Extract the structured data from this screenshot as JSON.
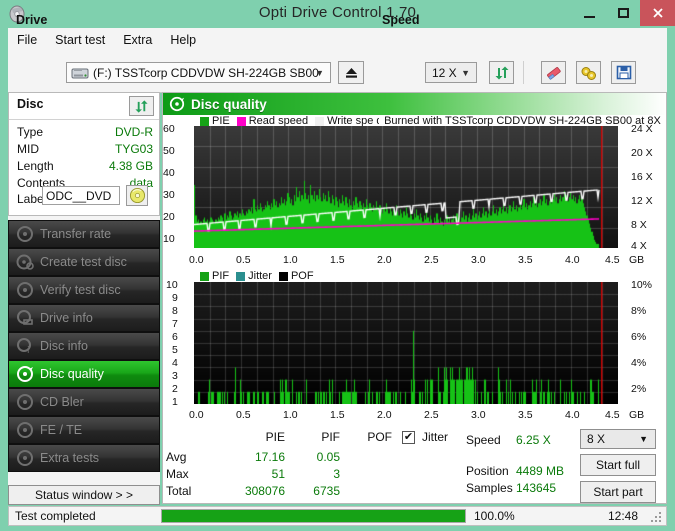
{
  "window": {
    "title": "Opti Drive Control 1.70",
    "icon": "disc-icon",
    "minimize": "minimize",
    "maximize": "maximize",
    "close": "close"
  },
  "menu": {
    "items": [
      "File",
      "Start test",
      "Extra",
      "Help"
    ]
  },
  "toolbar": {
    "drive_label": "Drive",
    "drive_value": "(F:)  TSSTcorp CDDVDW SH-224GB SB00",
    "eject_icon": "eject-icon",
    "speed_label": "Speed",
    "speed_value": "12 X",
    "refresh_icon": "refresh-icon",
    "erase_icon": "eraser-icon",
    "settings_icon": "gear-icon",
    "save_icon": "save-icon"
  },
  "disc": {
    "title": "Disc",
    "refresh_icon": "refresh-icon",
    "rows": [
      {
        "key": "Type",
        "value": "DVD-R"
      },
      {
        "key": "MID",
        "value": "TYG03"
      },
      {
        "key": "Length",
        "value": "4.38 GB"
      },
      {
        "key": "Contents",
        "value": "data"
      }
    ],
    "label_key": "Label",
    "label_value": "ODC__DVD",
    "label_button_icon": "cd-icon"
  },
  "sidebar": {
    "items": [
      {
        "label": "Transfer rate",
        "icon": "disc-icon",
        "active": false
      },
      {
        "label": "Create test disc",
        "icon": "disc-write-icon",
        "active": false
      },
      {
        "label": "Verify test disc",
        "icon": "disc-check-icon",
        "active": false
      },
      {
        "label": "Drive info",
        "icon": "drive-icon",
        "active": false
      },
      {
        "label": "Disc info",
        "icon": "disc-info-icon",
        "active": false
      },
      {
        "label": "Disc quality",
        "icon": "disc-quality-icon",
        "active": true
      },
      {
        "label": "CD Bler",
        "icon": "disc-icon",
        "active": false
      },
      {
        "label": "FE / TE",
        "icon": "disc-icon",
        "active": false
      },
      {
        "label": "Extra tests",
        "icon": "disc-icon",
        "active": false
      }
    ],
    "status_window": "Status window > >"
  },
  "panel": {
    "header": "Disc quality",
    "header_icon": "disc-quality-icon"
  },
  "chart_data": [
    {
      "type": "area",
      "title": "Disc quality",
      "annotation": "Burned with TSSTcorp CDDVDW SH-224GB SB00 at 8X",
      "legend": [
        {
          "label": "PIE",
          "color": "#16a216"
        },
        {
          "label": "Read speed",
          "color": "#ff00c8"
        },
        {
          "label": "Write spe  d",
          "color": "#f0f0f0"
        }
      ],
      "xlabel": "GB",
      "x_ticks": [
        "0.0",
        "0.5",
        "1.0",
        "1.5",
        "2.0",
        "2.5",
        "3.0",
        "3.5",
        "4.0",
        "4.5"
      ],
      "xlim": [
        0,
        4.5
      ],
      "ylabel_left": "PIE",
      "y_ticks_left": [
        "10",
        "20",
        "30",
        "40",
        "50",
        "60"
      ],
      "ylim_left": [
        0,
        60
      ],
      "ylabel_right": "Speed",
      "y_ticks_right": [
        "4 X",
        "8 X",
        "12 X",
        "16 X",
        "20 X",
        "24 X"
      ],
      "ylim_right": [
        0,
        26
      ],
      "series": [
        {
          "name": "PIE",
          "color": "#16c216",
          "values": [
            31,
            16,
            13,
            14,
            12,
            13,
            12,
            14,
            15,
            13,
            14,
            12,
            13,
            15,
            14,
            13,
            12,
            14,
            13,
            15,
            14,
            16,
            15,
            13,
            17,
            14,
            16,
            15,
            18,
            16,
            14,
            15,
            17,
            16,
            18,
            15,
            17,
            16,
            19,
            17,
            16,
            18,
            17,
            19,
            18,
            20,
            17,
            24,
            19,
            18,
            21,
            19,
            22,
            20,
            18,
            19,
            21,
            20,
            23,
            21,
            19,
            22,
            20,
            24,
            21,
            23,
            20,
            22,
            21,
            25,
            22,
            24,
            21,
            23,
            27,
            25,
            22,
            24,
            21,
            26,
            23,
            30,
            25,
            28,
            23,
            26,
            24,
            33,
            27,
            24,
            26,
            22,
            31,
            26,
            24,
            28,
            23,
            26,
            24,
            29,
            25,
            23,
            27,
            24,
            26,
            23,
            28,
            25,
            22,
            26,
            24,
            21,
            25,
            23,
            20,
            24,
            22,
            26,
            23,
            21,
            25,
            22,
            20,
            24,
            21,
            19,
            23,
            21,
            25,
            22,
            20,
            23,
            21,
            19,
            22,
            20,
            24,
            21,
            19,
            22,
            20,
            18,
            21,
            19,
            23,
            20,
            18,
            21,
            19,
            17,
            20,
            18,
            22,
            19,
            17,
            20,
            18,
            16,
            19,
            17,
            21,
            18,
            16,
            19,
            17,
            15,
            18,
            16,
            20,
            17,
            15,
            18,
            16,
            14,
            17,
            15,
            19,
            16,
            14,
            17,
            15,
            13,
            16,
            14,
            18,
            15,
            13,
            16,
            14,
            12,
            15,
            13,
            17,
            14,
            12,
            15,
            13,
            11,
            14,
            12,
            16,
            13,
            15,
            12,
            14,
            16,
            13,
            15,
            17,
            14,
            16,
            13,
            15,
            18,
            14,
            16,
            13,
            15,
            17,
            14,
            16,
            19,
            15,
            17,
            14,
            16,
            18,
            15,
            17,
            20,
            16,
            18,
            15,
            17,
            19,
            16,
            18,
            21,
            17,
            19,
            16,
            18,
            20,
            17,
            19,
            22,
            18,
            20,
            17,
            19,
            21,
            18,
            20,
            23,
            19,
            21,
            18,
            20,
            22,
            19,
            21,
            24,
            20,
            22,
            19,
            21,
            23,
            20,
            22,
            25,
            21,
            23,
            20,
            22,
            24,
            21,
            23,
            26,
            22,
            24,
            21,
            23,
            25,
            22,
            24,
            27,
            23,
            25,
            22,
            24,
            26,
            23,
            25,
            28,
            24,
            26,
            23,
            25,
            27,
            24,
            26,
            23,
            25,
            22,
            24,
            26,
            23,
            25,
            22,
            20,
            18,
            16,
            14,
            12,
            10,
            8,
            6,
            4,
            3,
            2,
            1
          ]
        },
        {
          "name": "Read speed",
          "color": "#ffffff",
          "unit": "X",
          "description": "staircase CAV read curve rising from ~5X to ~12X with periodic drops"
        },
        {
          "name": "Write speed",
          "color": "#ff00c8",
          "unit": "X",
          "description": "flat write speed line near 8X"
        }
      ]
    },
    {
      "type": "bar",
      "legend": [
        {
          "label": "PIF",
          "color": "#16a216"
        },
        {
          "label": "Jitter",
          "color": "#2b8f8f"
        },
        {
          "label": "POF",
          "color": "#000000"
        }
      ],
      "xlabel": "GB",
      "x_ticks": [
        "0.0",
        "0.5",
        "1.0",
        "1.5",
        "2.0",
        "2.5",
        "3.0",
        "3.5",
        "4.0",
        "4.5"
      ],
      "xlim": [
        0,
        4.5
      ],
      "ylabel_left": "PIF",
      "y_ticks_left": [
        "1",
        "2",
        "3",
        "4",
        "5",
        "6",
        "7",
        "8",
        "9",
        "10"
      ],
      "ylim_left": [
        0,
        10
      ],
      "ylabel_right": "Jitter",
      "y_ticks_right": [
        "2%",
        "4%",
        "6%",
        "8%",
        "10%"
      ],
      "ylim_right": [
        0,
        10
      ],
      "series": [
        {
          "name": "PIF",
          "color": "#16c216",
          "description": "sparse bars mostly 1-2, cluster of 2-3 near 2.8-3.1 GB, max 3"
        }
      ]
    }
  ],
  "stats": {
    "columns": [
      "PIE",
      "PIF",
      "POF"
    ],
    "jitter_label": "Jitter",
    "jitter_checked": true,
    "rows": [
      {
        "label": "Avg",
        "PIE": "17.16",
        "PIF": "0.05",
        "POF": ""
      },
      {
        "label": "Max",
        "PIE": "51",
        "PIF": "3",
        "POF": ""
      },
      {
        "label": "Total",
        "PIE": "308076",
        "PIF": "6735",
        "POF": ""
      }
    ],
    "speed_label": "Speed",
    "speed_value": "6.25 X",
    "position_label": "Position",
    "position_value": "4489 MB",
    "samples_label": "Samples",
    "samples_value": "143645",
    "speed_select": "8 X",
    "start_full": "Start full",
    "start_part": "Start part"
  },
  "statusbar": {
    "text": "Test completed",
    "progress": 100.0,
    "progress_text": "100.0%",
    "time": "12:48"
  }
}
